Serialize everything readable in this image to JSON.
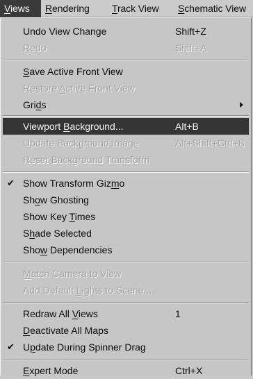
{
  "menubar": {
    "views": "Views",
    "rendering": "Rendering",
    "track_view": "Track View",
    "schematic_view": "Schematic View"
  },
  "menu": {
    "undo_view_change": {
      "label": "Undo View Change",
      "shortcut": "Shift+Z"
    },
    "redo": {
      "label": "Redo",
      "shortcut": "Shift+A"
    },
    "save_active_front_view": {
      "label": "Save Active Front View"
    },
    "restore_active_front_view": {
      "label": "Restore Active Front View"
    },
    "grids": {
      "label": "Grids"
    },
    "viewport_background": {
      "label": "Viewport Background...",
      "shortcut": "Alt+B"
    },
    "update_background_image": {
      "label": "Update Background Image",
      "shortcut": "Alt+Shift+Ctrl+B"
    },
    "reset_background_transform": {
      "label": "Reset Background Transform"
    },
    "show_transform_gizmo": {
      "label": "Show Transform Gizmo",
      "checked": true
    },
    "show_ghosting": {
      "label": "Show Ghosting"
    },
    "show_key_times": {
      "label": "Show Key Times"
    },
    "shade_selected": {
      "label": "Shade Selected"
    },
    "show_dependencies": {
      "label": "Show Dependencies"
    },
    "match_camera_to_view": {
      "label": "Match Camera to View"
    },
    "add_default_lights": {
      "label": "Add Default Lights to Scene..."
    },
    "redraw_all_views": {
      "label": "Redraw All Views",
      "shortcut": "1"
    },
    "deactivate_all_maps": {
      "label": "Deactivate All Maps"
    },
    "update_during_spinner_drag": {
      "label": "Update During Spinner Drag",
      "checked": true
    },
    "expert_mode": {
      "label": "Expert Mode",
      "shortcut": "Ctrl+X"
    },
    "check_glyph": "✔"
  }
}
